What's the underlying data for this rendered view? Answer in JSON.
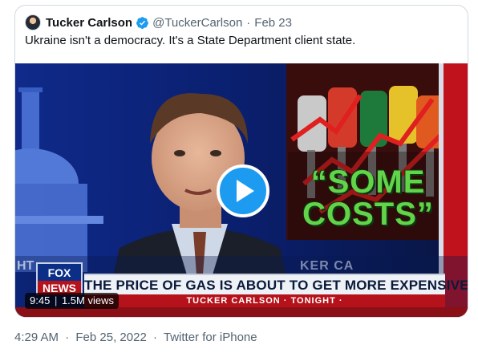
{
  "tweet": {
    "author_name": "Tucker Carlson",
    "handle": "@TuckerCarlson",
    "separator": "·",
    "date": "Feb 23",
    "text": "Ukraine isn't a democracy. It's a State Department client state."
  },
  "video": {
    "overlay_headline": "“SOME COSTS”",
    "chyron_main": "THE PRICE OF GAS IS ABOUT TO GET MORE EXPENSIVE",
    "chyron_sub": "TUCKER CARLSON · TONIGHT ·",
    "logo_top": "FOX",
    "logo_bottom": "NEWS",
    "ghost_left": "HT",
    "ghost_right": "KER CA",
    "duration": "9:45",
    "meta_separator": "|",
    "views": "1.5M views",
    "play_icon": "play-icon"
  },
  "footer": {
    "time": "4:29 AM",
    "separator": "·",
    "date": "Feb 25, 2022",
    "source": "Twitter for iPhone"
  },
  "colors": {
    "verified": "#1d9bf0",
    "play_button": "#1d9bf0",
    "chyron_red": "#b5121b",
    "headline_green": "#63d34a"
  }
}
